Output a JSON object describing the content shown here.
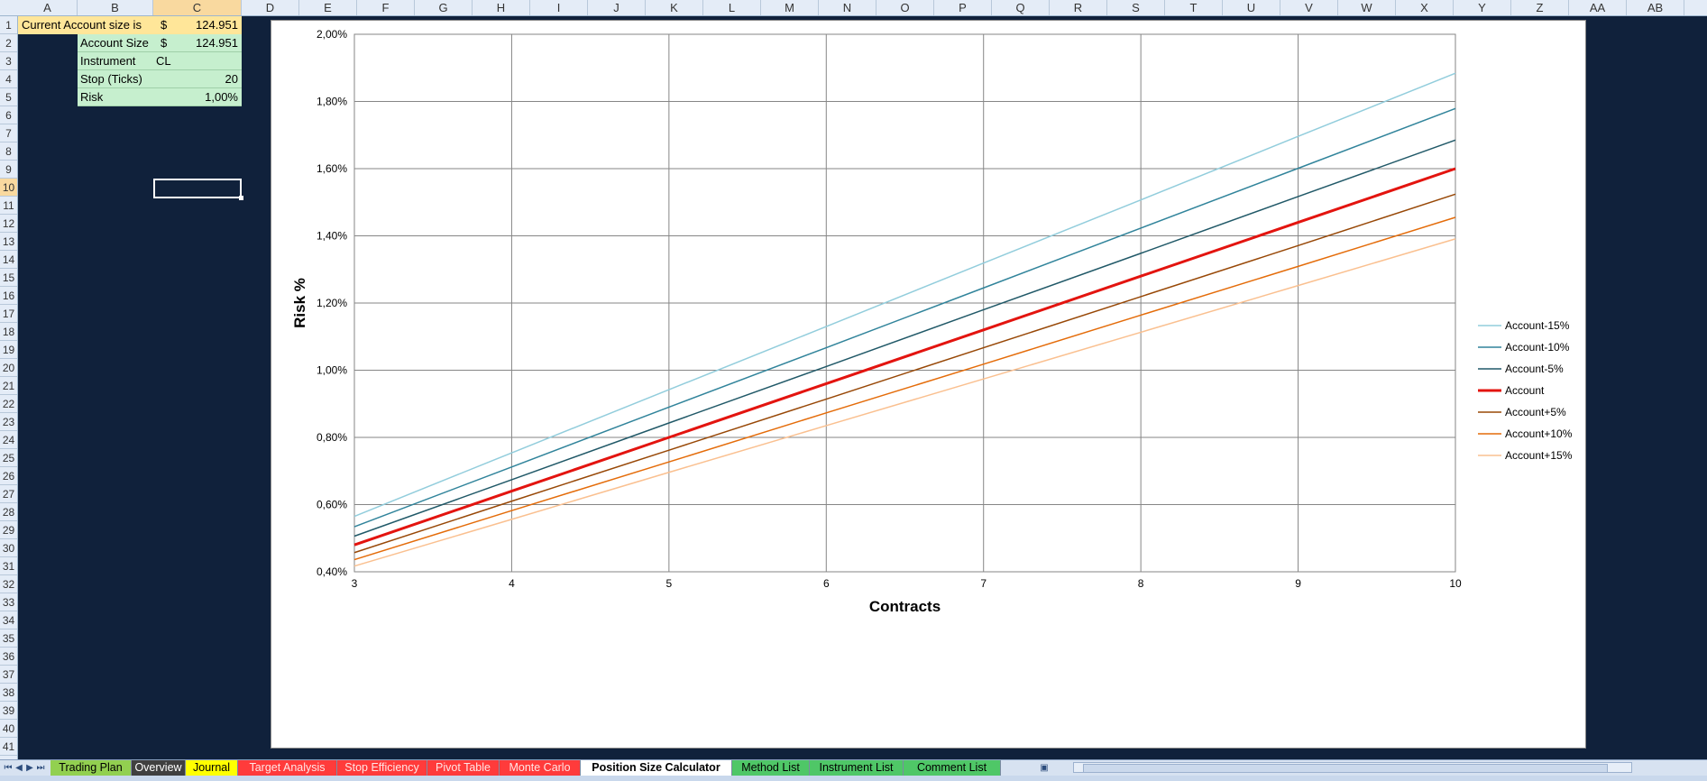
{
  "columns": [
    "A",
    "B",
    "C",
    "D",
    "E",
    "F",
    "G",
    "H",
    "I",
    "J",
    "K",
    "L",
    "M",
    "N",
    "O",
    "P",
    "Q",
    "R",
    "S",
    "T",
    "U",
    "V",
    "W",
    "X",
    "Y",
    "Z",
    "AA",
    "AB"
  ],
  "rows": [
    "1",
    "2",
    "3",
    "4",
    "5",
    "6",
    "7",
    "8",
    "9",
    "10",
    "11",
    "12",
    "13",
    "14",
    "15",
    "16",
    "17",
    "18",
    "19",
    "20",
    "21",
    "22",
    "23",
    "24",
    "25",
    "26",
    "27",
    "28",
    "29",
    "30",
    "31",
    "32",
    "33",
    "34",
    "35",
    "36",
    "37",
    "38",
    "39",
    "40",
    "41"
  ],
  "cells": {
    "a1": "Current Account size is",
    "c1_currency": "$",
    "c1_value": "124.951",
    "b2": "Account Size",
    "c2_currency": "$",
    "c2_value": "124.951",
    "b3": "Instrument",
    "c3": "CL",
    "b4": "Stop (Ticks)",
    "c4": "20",
    "b5": "Risk",
    "c5": "1,00%"
  },
  "sheet_tabs": [
    {
      "label": "Trading Plan",
      "color": "#92d050"
    },
    {
      "label": "Overview",
      "color": "#404040"
    },
    {
      "label": "Journal",
      "color": "#ffff00"
    },
    {
      "label": "Target Analysis",
      "color": "#ff3b3b"
    },
    {
      "label": "Stop Efficiency",
      "color": "#ff3b3b"
    },
    {
      "label": "Pivot Table",
      "color": "#ff3b3b"
    },
    {
      "label": "Monte Carlo",
      "color": "#ff3b3b"
    },
    {
      "label": "Position Size Calculator",
      "color": "#ffffff"
    },
    {
      "label": "Method List",
      "color": "#4fc767"
    },
    {
      "label": "Instrument List",
      "color": "#4fc767"
    },
    {
      "label": "Comment List",
      "color": "#4fc767"
    }
  ],
  "colors": {
    "background": "#10213b",
    "header": "#e4ecf7",
    "selected_header": "#f9d99f",
    "yellow_cell": "#ffe699",
    "green_cell": "#c6efce"
  },
  "chart_data": {
    "type": "line",
    "title": "",
    "xlabel": "Contracts",
    "ylabel": "Risk %",
    "x": [
      3,
      4,
      5,
      6,
      7,
      8,
      9,
      10
    ],
    "xlim": [
      3,
      10
    ],
    "ylim": [
      0.004,
      0.02
    ],
    "yticks": [
      "0,40%",
      "0,60%",
      "0,80%",
      "1,00%",
      "1,20%",
      "1,40%",
      "1,60%",
      "1,80%",
      "2,00%"
    ],
    "xticks": [
      "3",
      "4",
      "5",
      "6",
      "7",
      "8",
      "9",
      "10"
    ],
    "grid": true,
    "legend_position": "right",
    "series": [
      {
        "name": "Account-15%",
        "color": "#92cddc",
        "width": 1.5,
        "values": [
          0.00565,
          0.00754,
          0.00942,
          0.0113,
          0.01319,
          0.01507,
          0.01696,
          0.01884
        ]
      },
      {
        "name": "Account-10%",
        "color": "#31849b",
        "width": 1.5,
        "values": [
          0.00534,
          0.00712,
          0.0089,
          0.01067,
          0.01245,
          0.01423,
          0.01601,
          0.01779
        ]
      },
      {
        "name": "Account-5%",
        "color": "#215968",
        "width": 1.5,
        "values": [
          0.00506,
          0.00674,
          0.00843,
          0.01011,
          0.0118,
          0.01348,
          0.01517,
          0.01685
        ]
      },
      {
        "name": "Account",
        "color": "#e3140f",
        "width": 3,
        "values": [
          0.0048,
          0.0064,
          0.008,
          0.0096,
          0.0112,
          0.0128,
          0.0144,
          0.016
        ]
      },
      {
        "name": "Account+5%",
        "color": "#984807",
        "width": 1.5,
        "values": [
          0.00457,
          0.0061,
          0.00762,
          0.00914,
          0.01067,
          0.01219,
          0.01371,
          0.01524
        ]
      },
      {
        "name": "Account+10%",
        "color": "#e46c0a",
        "width": 1.5,
        "values": [
          0.00436,
          0.00582,
          0.00727,
          0.00873,
          0.01018,
          0.01164,
          0.01309,
          0.01455
        ]
      },
      {
        "name": "Account+15%",
        "color": "#fac090",
        "width": 1.5,
        "values": [
          0.00417,
          0.00556,
          0.00696,
          0.00835,
          0.00974,
          0.01113,
          0.01252,
          0.01391
        ]
      }
    ]
  }
}
